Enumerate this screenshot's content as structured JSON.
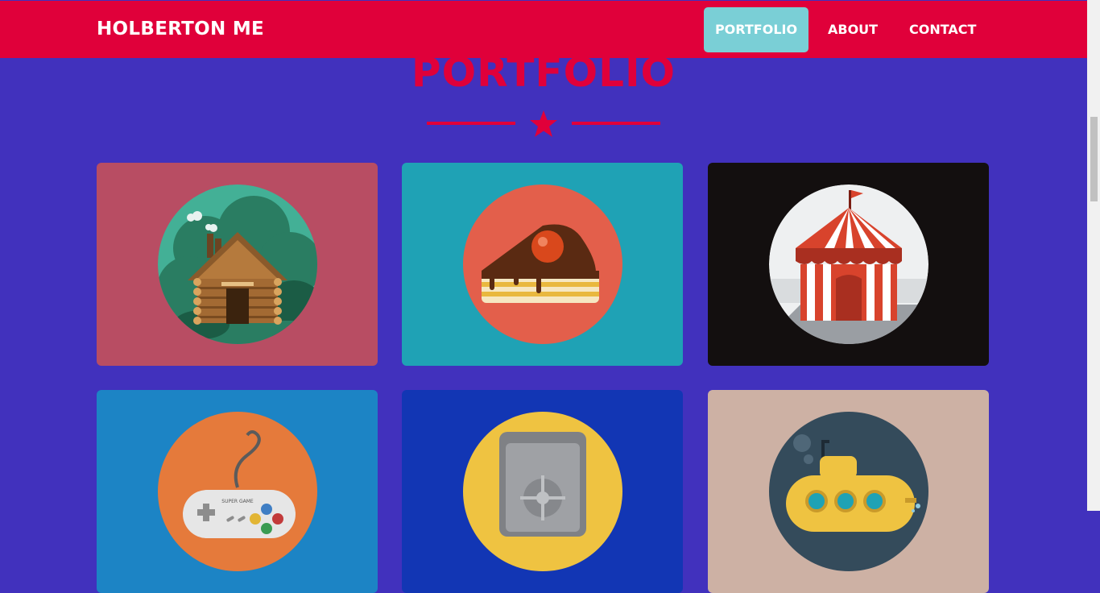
{
  "navbar": {
    "brand": "HOLBERTON ME",
    "links": [
      {
        "label": "PORTFOLIO",
        "active": true
      },
      {
        "label": "ABOUT",
        "active": false
      },
      {
        "label": "CONTACT",
        "active": false
      }
    ]
  },
  "section": {
    "title": "PORTFOLIO",
    "divider_icon": "star-icon"
  },
  "portfolio": {
    "items": [
      {
        "icon": "log-cabin-icon",
        "background": "#b84d63"
      },
      {
        "icon": "cake-slice-icon",
        "background": "#1fa2b5"
      },
      {
        "icon": "circus-tent-icon",
        "background": "#130f0f"
      },
      {
        "icon": "game-controller-icon",
        "background": "#1c84c5",
        "controller_text": "SUPER GAME"
      },
      {
        "icon": "safe-icon",
        "background": "#1236b4"
      },
      {
        "icon": "submarine-icon",
        "background": "#cdb1a4"
      }
    ]
  },
  "colors": {
    "page_background": "#4131bd",
    "navbar": "#e0003a",
    "active_nav": "#7acfd6",
    "title": "#e0003a"
  }
}
